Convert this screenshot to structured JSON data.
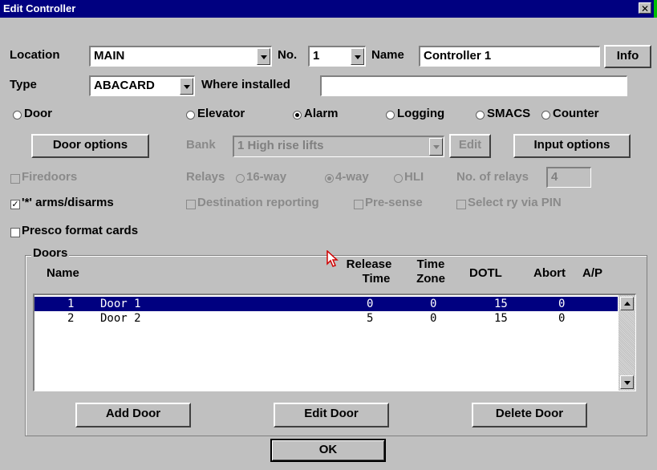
{
  "window": {
    "title": "Edit Controller",
    "close_glyph": "✕"
  },
  "location": {
    "label": "Location",
    "value": "MAIN"
  },
  "number": {
    "label": "No.",
    "value": "1"
  },
  "name": {
    "label": "Name",
    "value": "Controller 1"
  },
  "info_button": "Info",
  "type": {
    "label": "Type",
    "value": "ABACARD"
  },
  "where_installed": {
    "label": "Where installed",
    "value": ""
  },
  "controller_kind": {
    "options": [
      "Door",
      "Elevator",
      "Alarm",
      "Logging",
      "SMACS",
      "Counter"
    ],
    "selected": "Alarm"
  },
  "door_options_button": "Door options",
  "bank": {
    "label": "Bank",
    "value": "1 High rise lifts"
  },
  "edit_bank_button": "Edit",
  "input_options_button": "Input options",
  "firedoors": {
    "label": "Firedoors",
    "checked": false
  },
  "relays": {
    "label": "Relays",
    "options": [
      "16-way",
      "4-way",
      "HLI"
    ],
    "selected": "4-way"
  },
  "num_relays": {
    "label": "No. of relays",
    "value": "4"
  },
  "arms_disarms": {
    "label": "'*' arms/disarms",
    "checked": true,
    "check_glyph": "✓"
  },
  "destination_reporting": {
    "label": "Destination reporting",
    "checked": false
  },
  "pre_sense": {
    "label": "Pre-sense",
    "checked": false
  },
  "select_ry_via_pin": {
    "label": "Select ry via PIN",
    "checked": false
  },
  "presco_format": {
    "label": "Presco format cards",
    "checked": false
  },
  "doors": {
    "group_label": "Doors",
    "columns": {
      "name": "Name",
      "release_time": [
        "Release",
        "Time"
      ],
      "time_zone": [
        "Time",
        "Zone"
      ],
      "dotl": "DOTL",
      "abort": "Abort",
      "ap": "A/P"
    },
    "rows": [
      {
        "num": "1",
        "name": "Door 1",
        "release": "0",
        "zone": "0",
        "dotl": "15",
        "abort": "0",
        "selected": true
      },
      {
        "num": "2",
        "name": "Door 2",
        "release": "5",
        "zone": "0",
        "dotl": "15",
        "abort": "0",
        "selected": false
      }
    ],
    "add_button": "Add Door",
    "edit_button": "Edit Door",
    "delete_button": "Delete Door"
  },
  "ok_button": "OK"
}
